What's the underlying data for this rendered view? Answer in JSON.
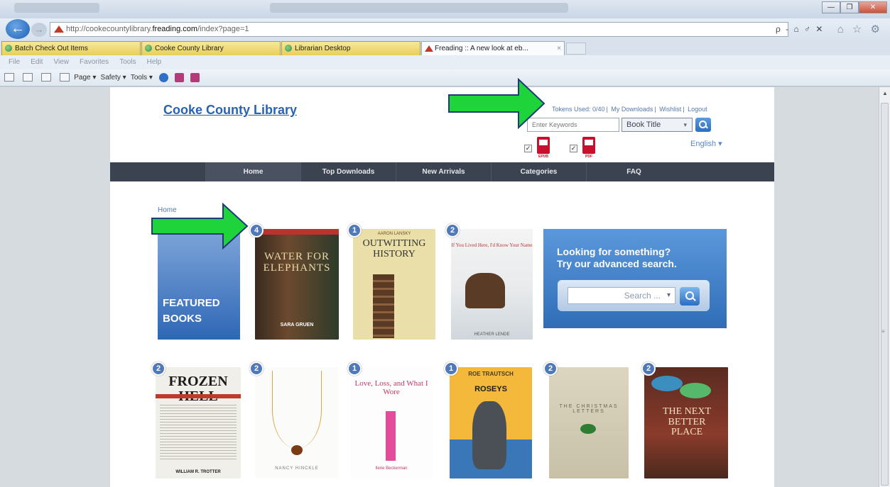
{
  "browser": {
    "url_prefix": "http://cookecountylibrary.",
    "url_domain": "freading.com",
    "url_suffix": "/index?page=1",
    "addr_tools": "ρ - ⌂ ♂ ✕",
    "addr_right": "⌂ ☆ ⚙",
    "win_min": "—",
    "win_max": "❐",
    "win_close": "✕",
    "tabs": [
      {
        "label": "Batch Check Out Items"
      },
      {
        "label": "Cooke County Library"
      },
      {
        "label": "Librarian Desktop"
      },
      {
        "label": "Freading :: A new look at eb..."
      }
    ],
    "menu": [
      "File",
      "Edit",
      "View",
      "Favorites",
      "Tools",
      "Help"
    ],
    "commands": {
      "page": "Page ▾",
      "safety": "Safety ▾",
      "tools": "Tools ▾"
    }
  },
  "site": {
    "title": "Cooke County Library",
    "top_links": [
      "Tokens Used: 0/40",
      "My Downloads",
      "Wishlist",
      "Logout"
    ],
    "search_placeholder": "Enter Keywords",
    "search_type": "Book Title",
    "formats": [
      {
        "label": "EPUB"
      },
      {
        "label": "PDF"
      }
    ],
    "check_mark": "✓",
    "language": "English ▾",
    "nav": [
      "Home",
      "Top Downloads",
      "New Arrivals",
      "Categories",
      "FAQ"
    ],
    "breadcrumb": "Home",
    "featured_label_1": "FEATURED",
    "featured_label_2": "BOOKS",
    "advanced": {
      "line1": "Looking for something?",
      "line2": "Try our advanced search.",
      "select": "Search ..."
    }
  },
  "books_row1": [
    {
      "badge": "4",
      "title": "WATER FOR ELEPHANTS",
      "author": "SARA GRUEN"
    },
    {
      "badge": "1",
      "title": "OUTWITTING HISTORY",
      "author": "AARON LANSKY"
    },
    {
      "badge": "2",
      "title": "If You Lived Here, I'd Know Your Name",
      "author": "HEATHER LENDE"
    }
  ],
  "books_row2": [
    {
      "badge": "2",
      "title": "FROZEN HELL",
      "author": "WILLIAM R. TROTTER"
    },
    {
      "badge": "2",
      "title": "",
      "author": "NANCY HINCKLE"
    },
    {
      "badge": "1",
      "title": "Love, Loss, and What I Wore",
      "author": "Ilene Beckerman"
    },
    {
      "badge": "1",
      "title": "ROSEYS",
      "author": ""
    },
    {
      "badge": "2",
      "title": "THE CHRISTMAS LETTERS",
      "author": ""
    },
    {
      "badge": "2",
      "title": "THE NEXT BETTER PLACE",
      "author": ""
    }
  ],
  "colors": {
    "accent": "#2a62b0",
    "nav_bg": "#3b4350",
    "annotation": "#1fd43b"
  }
}
